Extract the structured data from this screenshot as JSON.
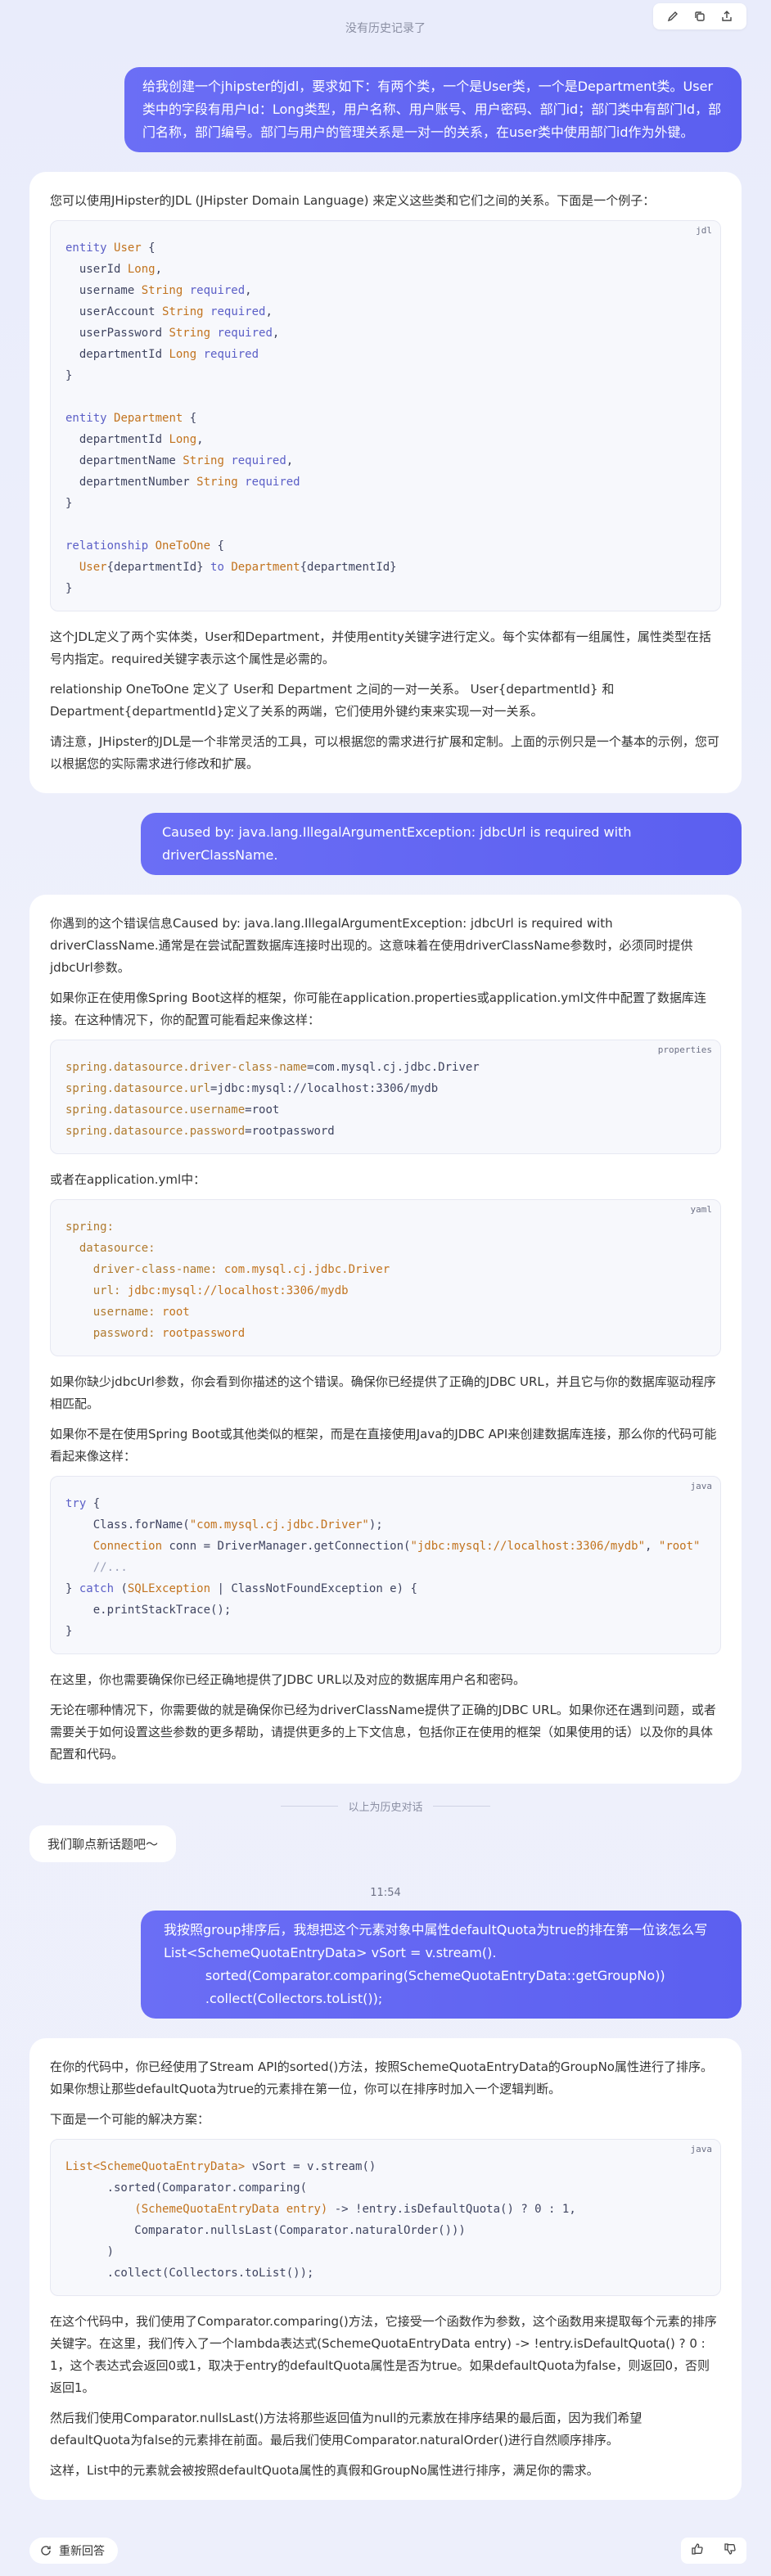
{
  "topbar": {
    "no_history": "没有历史记录了",
    "tools": [
      "edit-icon",
      "copy-icon",
      "share-icon"
    ]
  },
  "conversation": {
    "q1": "给我创建一个jhipster的jdl，要求如下：有两个类，一个是User类，一个是Department类。User类中的字段有用户Id：Long类型，用户名称、用户账号、用户密码、部门id；部门类中有部门Id，部门名称，部门编号。部门与用户的管理关系是一对一的关系，在user类中使用部门id作为外键。",
    "a1": {
      "intro": "您可以使用JHipster的JDL (JHipster Domain Language) 来定义这些类和它们之间的关系。下面是一个例子：",
      "code_lang": "jdl",
      "p1": "这个JDL定义了两个实体类，User和Department，并使用entity关键字进行定义。每个实体都有一组属性，属性类型在括号内指定。required关键字表示这个属性是必需的。",
      "p2": "relationship OneToOne 定义了 User和 Department 之间的一对一关系。 User{departmentId} 和 Department{departmentId}定义了关系的两端，它们使用外键约束来实现一对一关系。",
      "p3": "请注意，JHipster的JDL是一个非常灵活的工具，可以根据您的需求进行扩展和定制。上面的示例只是一个基本的示例，您可以根据您的实际需求进行修改和扩展。"
    },
    "q2": "Caused by: java.lang.IllegalArgumentException: jdbcUrl is required with driverClassName.",
    "a2": {
      "p1": "你遇到的这个错误信息Caused by: java.lang.IllegalArgumentException: jdbcUrl is required with driverClassName.通常是在尝试配置数据库连接时出现的。这意味着在使用driverClassName参数时，必须同时提供jdbcUrl参数。",
      "p2": "如果你正在使用像Spring Boot这样的框架，你可能在application.properties或application.yml文件中配置了数据库连接。在这种情况下，你的配置可能看起来像这样：",
      "code1_lang": "properties",
      "p3": "或者在application.yml中：",
      "code2_lang": "yaml",
      "p4": "如果你缺少jdbcUrl参数，你会看到你描述的这个错误。确保你已经提供了正确的JDBC URL，并且它与你的数据库驱动程序相匹配。",
      "p5": "如果你不是在使用Spring Boot或其他类似的框架，而是在直接使用Java的JDBC API来创建数据库连接，那么你的代码可能看起来像这样：",
      "code3_lang": "java",
      "p6": "在这里，你也需要确保你已经正确地提供了JDBC URL以及对应的数据库用户名和密码。",
      "p7": "无论在哪种情况下，你需要做的就是确保你已经为driverClassName提供了正确的JDBC URL。如果你还在遇到问题，或者需要关于如何设置这些参数的更多帮助，请提供更多的上下文信息，包括你正在使用的框架（如果使用的话）以及你的具体配置和代码。"
    },
    "divider": "以上为历史对话",
    "new_topic": "我们聊点新话题吧～",
    "time": "11:54",
    "q3": "我按照group排序后，我想把这个元素对象中属性defaultQuota为true的排在第一位该怎么写List<SchemeQuotaEntryData> vSort = v.stream().\n          sorted(Comparator.comparing(SchemeQuotaEntryData::getGroupNo))\n          .collect(Collectors.toList());",
    "a3": {
      "p1": "在你的代码中，你已经使用了Stream API的sorted()方法，按照SchemeQuotaEntryData的GroupNo属性进行了排序。如果你想让那些defaultQuota为true的元素排在第一位，你可以在排序时加入一个逻辑判断。",
      "p2": "下面是一个可能的解决方案：",
      "code_lang": "java",
      "p3": "在这个代码中，我们使用了Comparator.comparing()方法，它接受一个函数作为参数，这个函数用来提取每个元素的排序关键字。在这里，我们传入了一个lambda表达式(SchemeQuotaEntryData entry) -> !entry.isDefaultQuota() ? 0 : 1，这个表达式会返回0或1，取决于entry的defaultQuota属性是否为true。如果defaultQuota为false，则返回0，否则返回1。",
      "p4": "然后我们使用Comparator.nullsLast()方法将那些返回值为null的元素放在排序结果的最后面，因为我们希望defaultQuota为false的元素排在前面。最后我们使用Comparator.naturalOrder()进行自然顺序排序。",
      "p5": "这样，List中的元素就会被按照defaultQuota属性的真假和GroupNo属性进行排序，满足你的需求。"
    }
  },
  "bottombar": {
    "regenerate": "重新回答",
    "feedback": [
      "thumbs-up-icon",
      "thumbs-down-icon"
    ]
  }
}
